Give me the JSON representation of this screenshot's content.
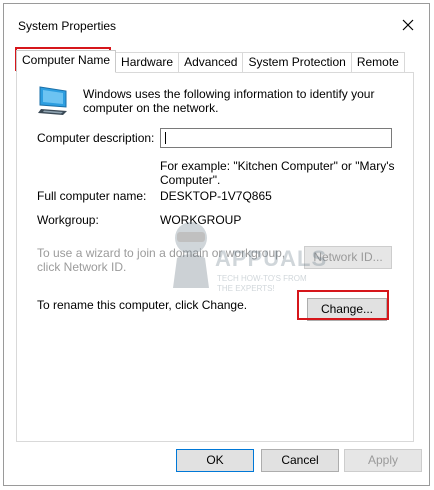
{
  "window": {
    "title": "System Properties"
  },
  "tabs": [
    "Computer Name",
    "Hardware",
    "Advanced",
    "System Protection",
    "Remote"
  ],
  "intro_text": "Windows uses the following information to identify your computer on the network.",
  "fields": {
    "description_label": "Computer description:",
    "description_value": "",
    "example_text": "For example: \"Kitchen Computer\" or \"Mary's Computer\".",
    "full_name_label": "Full computer name:",
    "full_name_value": "DESKTOP-1V7Q865",
    "workgroup_label": "Workgroup:",
    "workgroup_value": "WORKGROUP"
  },
  "network_id": {
    "text": "To use a wizard to join a domain or workgroup, click Network ID.",
    "button": "Network ID..."
  },
  "rename": {
    "text": "To rename this computer, click Change.",
    "button": "Change..."
  },
  "footer": {
    "ok": "OK",
    "cancel": "Cancel",
    "apply": "Apply"
  },
  "watermark": {
    "brand": "APPUALS",
    "tagline": "TECH HOW-TO'S FROM THE EXPERTS!"
  },
  "colors": {
    "highlight": "#d6161b",
    "accent": "#0078d7",
    "disabled": "#9b9b9b"
  }
}
